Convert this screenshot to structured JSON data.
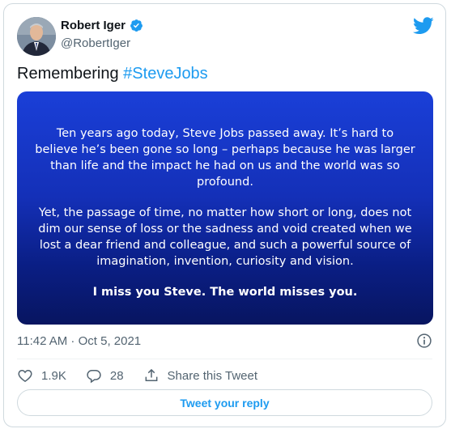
{
  "author": {
    "display_name": "Robert Iger",
    "handle": "@RobertIger",
    "verified": true
  },
  "tweet": {
    "text_prefix": "Remembering ",
    "hashtag": "#SteveJobs",
    "image_text": {
      "para1": "Ten years ago today, Steve Jobs passed away. It’s hard to believe he’s been gone so long – perhaps because he was larger than life and the impact he had on us and the world was so profound.",
      "para2": "Yet, the passage of time, no matter how short or long, does not dim our sense of loss or the sadness and void created when we lost a dear friend and colleague, and such a powerful source of imagination, invention, curiosity and vision.",
      "closing": "I miss you Steve. The world misses you."
    },
    "timestamp": "11:42 AM · Oct 5, 2021"
  },
  "actions": {
    "likes": "1.9K",
    "replies": "28",
    "share_label": "Share this Tweet",
    "reply_button": "Tweet your reply"
  },
  "icons": {
    "brand": "twitter-bird-icon",
    "verified": "verified-badge-icon",
    "info": "info-icon",
    "like": "heart-icon",
    "reply": "reply-bubble-icon",
    "share": "share-icon"
  },
  "colors": {
    "accent": "#1d9bf0",
    "text": "#0f1419",
    "muted": "#536471",
    "image_background": "#1430b8"
  }
}
